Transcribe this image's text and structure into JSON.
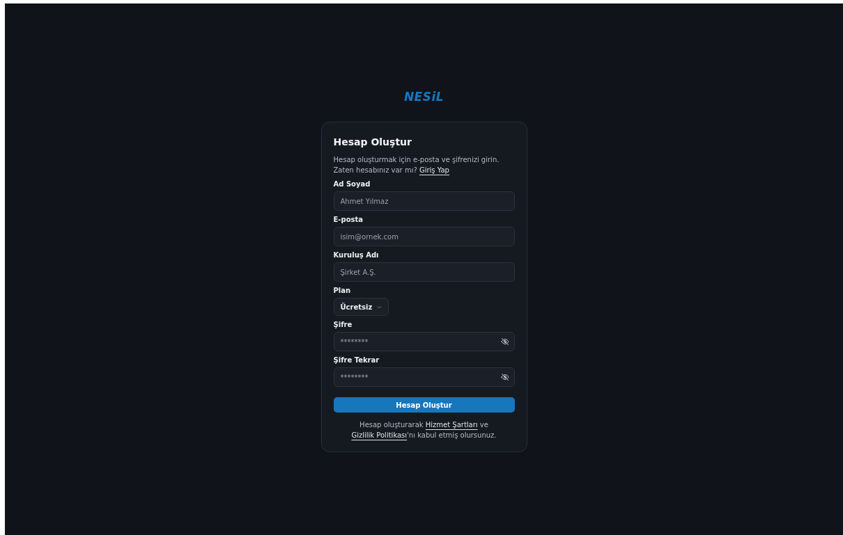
{
  "logo": "NESiL",
  "card": {
    "title": "Hesap Oluştur",
    "description": "Hesap oluşturmak için e-posta ve şifrenizi girin.",
    "login_prompt": [
      {
        "kind": "text",
        "text": "Zaten hesabınız var mı? "
      },
      {
        "kind": "link",
        "text": "Giriş Yap"
      }
    ],
    "fields": [
      {
        "kind": "text",
        "label": "Ad Soyad",
        "placeholder": "Ahmet Yılmaz"
      },
      {
        "kind": "text",
        "label": "E-posta",
        "placeholder": "isim@ornek.com"
      },
      {
        "kind": "text",
        "label": "Kuruluş Adı",
        "placeholder": "Şirket A.Ş."
      },
      {
        "kind": "select",
        "label": "Plan",
        "value": "Ücretsiz"
      },
      {
        "kind": "password",
        "label": "Şifre",
        "placeholder": "********"
      },
      {
        "kind": "password",
        "label": "Şifre Tekrar",
        "placeholder": "********"
      }
    ],
    "submit": "Hesap Oluştur",
    "terms": [
      {
        "kind": "text",
        "text": "Hesap oluşturarak "
      },
      {
        "kind": "link",
        "text": "Hizmet Şartları"
      },
      {
        "kind": "text",
        "text": " ve "
      },
      {
        "kind": "link",
        "text": "Gizlilik Politikası"
      },
      {
        "kind": "text",
        "text": "'nı kabul etmiş olursunuz."
      }
    ]
  }
}
